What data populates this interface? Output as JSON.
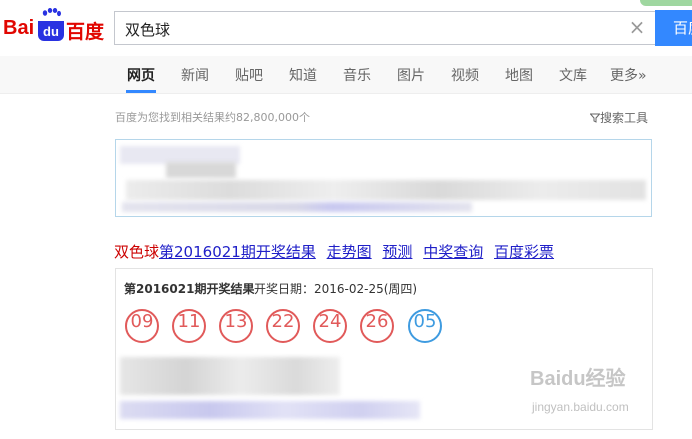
{
  "logo": {
    "bai": "Bai",
    "du": "du",
    "cn": "百度"
  },
  "search": {
    "query": "双色球",
    "clear_icon": "close-icon",
    "button_label": "百度一下"
  },
  "nav": {
    "items": [
      "网页",
      "新闻",
      "贴吧",
      "知道",
      "音乐",
      "图片",
      "视频",
      "地图",
      "文库",
      "更多»"
    ],
    "active": "网页"
  },
  "result_count": "百度为您找到相关结果约82,800,000个",
  "search_tools": "搜索工具",
  "result": {
    "title_highlight": "双色球",
    "title_rest": "第2016021期开奖结果",
    "links": [
      "走势图",
      "预测",
      "中奖查询",
      "百度彩票"
    ],
    "issue_title": "第2016021期开奖结果",
    "draw_date": "开奖日期：2016-02-25(周四)",
    "red_balls": [
      "09",
      "11",
      "13",
      "22",
      "24",
      "26"
    ],
    "blue_ball": "05"
  },
  "watermark": {
    "main": "Baidu经验",
    "sub": "jingyan.baidu.com"
  },
  "colors": {
    "brand_red": "#e10601",
    "brand_blue": "#2932e1",
    "link": "#2020c8",
    "red_ball": "#e15a5a",
    "blue_ball": "#3e9be0",
    "search_button": "#3388ff"
  }
}
